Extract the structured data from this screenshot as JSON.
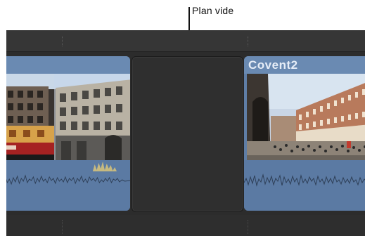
{
  "callout": {
    "label": "Plan vide"
  },
  "timeline": {
    "clips": [
      {
        "title": ""
      },
      {
        "title": ""
      },
      {
        "title": "Covent2"
      }
    ]
  }
}
